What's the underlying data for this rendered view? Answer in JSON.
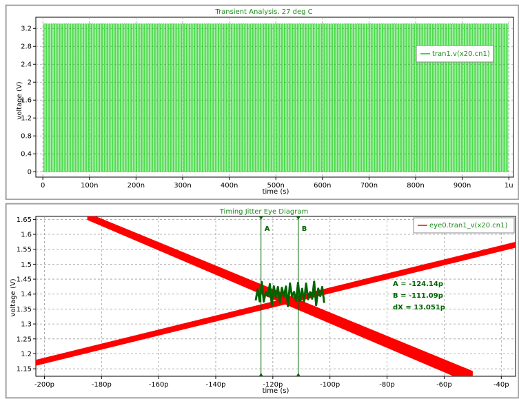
{
  "chart_data": [
    {
      "type": "line",
      "title": "Transient Analysis, 27 deg C",
      "xlabel": "time (s)",
      "ylabel": "voltage (V)",
      "xlim": [
        -1.5e-08,
        1.01e-06
      ],
      "ylim": [
        -0.12,
        3.45
      ],
      "grid": true,
      "legend_position": "top-right",
      "x_ticks": [
        {
          "value": 0,
          "label": "0"
        },
        {
          "value": 1e-07,
          "label": "100n"
        },
        {
          "value": 2e-07,
          "label": "200n"
        },
        {
          "value": 3e-07,
          "label": "300n"
        },
        {
          "value": 4e-07,
          "label": "400n"
        },
        {
          "value": 5e-07,
          "label": "500n"
        },
        {
          "value": 6e-07,
          "label": "600n"
        },
        {
          "value": 7e-07,
          "label": "700n"
        },
        {
          "value": 8e-07,
          "label": "800n"
        },
        {
          "value": 9e-07,
          "label": "900n"
        },
        {
          "value": 1e-06,
          "label": "1u"
        }
      ],
      "y_ticks": [
        {
          "value": 0,
          "label": "0"
        },
        {
          "value": 0.4,
          "label": "0.4"
        },
        {
          "value": 0.8,
          "label": "0.8"
        },
        {
          "value": 1.2,
          "label": "1.2"
        },
        {
          "value": 1.6,
          "label": "1.6"
        },
        {
          "value": 2.0,
          "label": "2"
        },
        {
          "value": 2.4,
          "label": "2.4"
        },
        {
          "value": 2.8,
          "label": "2.8"
        },
        {
          "value": 3.2,
          "label": "3.2"
        }
      ],
      "series": [
        {
          "name": "tran1.v(x20.cn1)",
          "color": "#00cc00",
          "description": "square wave toggling between 0 V and 3.3 V",
          "low": 0,
          "high": 3.3,
          "period": 4e-09,
          "t_start": 0,
          "t_end": 1e-06
        }
      ]
    },
    {
      "type": "line",
      "title": "Timing Jitter Eye Diagram",
      "xlabel": "time (s)",
      "ylabel": "voltage (V)",
      "xlim": [
        -2.03e-10,
        -3.5e-11
      ],
      "ylim": [
        1.125,
        1.66
      ],
      "grid": true,
      "legend_position": "top-right",
      "x_ticks": [
        {
          "value": -2e-10,
          "label": "-200p"
        },
        {
          "value": -1.8e-10,
          "label": "-180p"
        },
        {
          "value": -1.6e-10,
          "label": "-160p"
        },
        {
          "value": -1.4e-10,
          "label": "-140p"
        },
        {
          "value": -1.2e-10,
          "label": "-120p"
        },
        {
          "value": -1e-10,
          "label": "-100p"
        },
        {
          "value": -8e-11,
          "label": "-80p"
        },
        {
          "value": -6e-11,
          "label": "-60p"
        },
        {
          "value": -4e-11,
          "label": "-40p"
        }
      ],
      "y_ticks": [
        {
          "value": 1.15,
          "label": "1.15"
        },
        {
          "value": 1.2,
          "label": "1.2"
        },
        {
          "value": 1.25,
          "label": "1.25"
        },
        {
          "value": 1.3,
          "label": "1.3"
        },
        {
          "value": 1.35,
          "label": "1.35"
        },
        {
          "value": 1.4,
          "label": "1.4"
        },
        {
          "value": 1.45,
          "label": "1.45"
        },
        {
          "value": 1.5,
          "label": "1.5"
        },
        {
          "value": 1.55,
          "label": "1.55"
        },
        {
          "value": 1.6,
          "label": "1.6"
        },
        {
          "value": 1.65,
          "label": "1.65"
        }
      ],
      "series": [
        {
          "name": "eye0.tran1_v(x20.cn1)",
          "color": "#ff0000",
          "description": "overlaid rising and falling edges forming an eye crossing",
          "rising_edge": {
            "x": [
              -2.03e-10,
              -3.5e-11
            ],
            "y_center": [
              1.17,
              1.565
            ],
            "band_width": 0.02
          },
          "falling_edge": {
            "x": [
              -1.85e-10,
              -5e-11
            ],
            "y_center": [
              1.66,
              1.12
            ],
            "band_width_start": 0.024,
            "band_width_end": 0.045
          }
        },
        {
          "color": "#006400",
          "description": "jitter measurement trace ringing around the crossing",
          "x": [
            -1.26e-10,
            -1.15e-10,
            -1.13e-10,
            -1.02e-10
          ],
          "y": [
            1.36,
            1.4,
            1.35,
            1.41
          ]
        }
      ],
      "markers": [
        {
          "label": "A",
          "x": -1.2414e-10,
          "color": "#006400"
        },
        {
          "label": "B",
          "x": -1.1109e-10,
          "color": "#006400"
        }
      ],
      "annotations": [
        "A = -124.14p",
        "B = -111.09p",
        "dX = 13.051p"
      ]
    }
  ]
}
